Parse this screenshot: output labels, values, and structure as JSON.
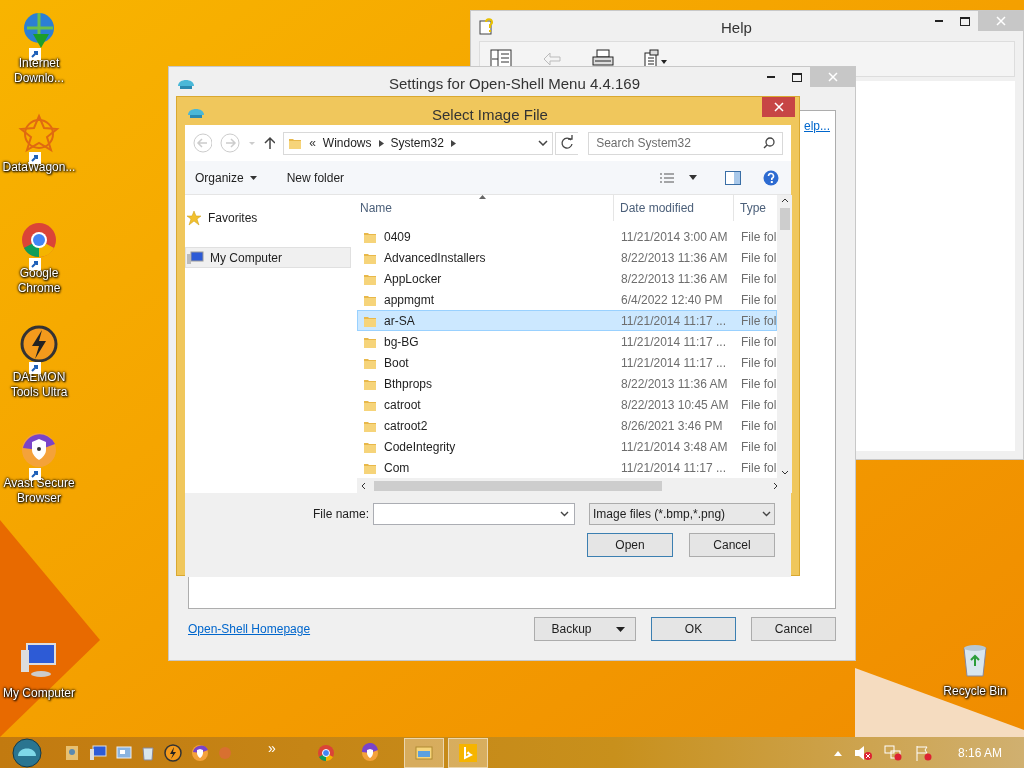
{
  "desktop_icons": [
    {
      "label": "Internet Downlo..."
    },
    {
      "label": "DataWagon..."
    },
    {
      "label": "Google Chrome"
    },
    {
      "label": "DAEMON Tools Ultra"
    },
    {
      "label": "Avast Secure Browser"
    },
    {
      "label": "My Computer"
    },
    {
      "label": "Recycle Bin"
    }
  ],
  "help_window": {
    "title": "Help"
  },
  "settings_window": {
    "title": "Settings for Open-Shell Menu 4.4.169",
    "help_link": "elp...",
    "homepage_link": "Open-Shell Homepage",
    "buttons": [
      {
        "label": "Backup",
        "kind": "split",
        "default": false
      },
      {
        "label": "OK",
        "kind": "plain",
        "default": true
      },
      {
        "label": "Cancel",
        "kind": "plain",
        "default": false
      }
    ]
  },
  "dialog": {
    "title": "Select Image File",
    "path_overflow": "«",
    "breadcrumb": [
      "Windows",
      "System32"
    ],
    "search": {
      "placeholder": "Search System32"
    },
    "commands": [
      "Organize",
      "New folder"
    ],
    "nav": [
      {
        "label": "Favorites",
        "selected": false
      },
      {
        "label": "My Computer",
        "selected": true
      }
    ],
    "columns": [
      "Name",
      "Date modified",
      "Type"
    ],
    "rows": [
      {
        "name": "0409",
        "date": "11/21/2014 3:00 AM",
        "type": "File fol",
        "selected": false
      },
      {
        "name": "AdvancedInstallers",
        "date": "8/22/2013 11:36 AM",
        "type": "File fol",
        "selected": false
      },
      {
        "name": "AppLocker",
        "date": "8/22/2013 11:36 AM",
        "type": "File fol",
        "selected": false
      },
      {
        "name": "appmgmt",
        "date": "6/4/2022 12:40 PM",
        "type": "File fol",
        "selected": false
      },
      {
        "name": "ar-SA",
        "date": "11/21/2014 11:17 ...",
        "type": "File fol",
        "selected": true
      },
      {
        "name": "bg-BG",
        "date": "11/21/2014 11:17 ...",
        "type": "File fol",
        "selected": false
      },
      {
        "name": "Boot",
        "date": "11/21/2014 11:17 ...",
        "type": "File fol",
        "selected": false
      },
      {
        "name": "Bthprops",
        "date": "8/22/2013 11:36 AM",
        "type": "File fol",
        "selected": false
      },
      {
        "name": "catroot",
        "date": "8/22/2013 10:45 AM",
        "type": "File fol",
        "selected": false
      },
      {
        "name": "catroot2",
        "date": "8/26/2021 3:46 PM",
        "type": "File fol",
        "selected": false
      },
      {
        "name": "CodeIntegrity",
        "date": "11/21/2014 3:48 AM",
        "type": "File fol",
        "selected": false
      },
      {
        "name": "Com",
        "date": "11/21/2014 11:17 ...",
        "type": "File fol",
        "selected": false
      }
    ],
    "file_name_label": "File name:",
    "file_type": "Image files (*.bmp,*.png)",
    "buttons": [
      {
        "label": "Open",
        "default": true
      },
      {
        "label": "Cancel",
        "default": false
      }
    ]
  },
  "taskbar": {
    "overflow": "»",
    "window_buttons": [
      {
        "running": false
      },
      {
        "running": false
      },
      {
        "running": true
      },
      {
        "running": true
      }
    ],
    "clock": "8:16 AM"
  }
}
